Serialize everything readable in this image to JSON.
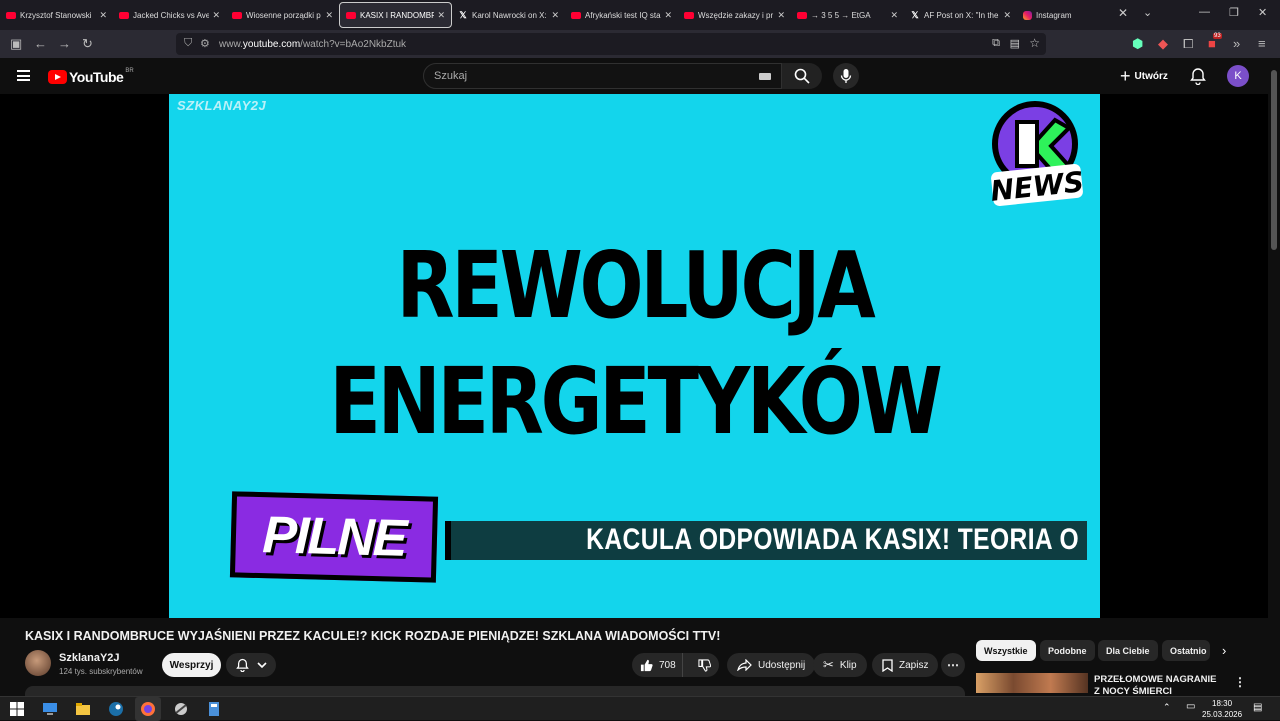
{
  "browser": {
    "tabs": [
      {
        "title": "Krzysztof Stanowski",
        "icon": "youtube-icon",
        "active": false
      },
      {
        "title": "Jacked Chicks vs Aver",
        "icon": "youtube-icon",
        "active": false
      },
      {
        "title": "Wiosenne porządki p",
        "icon": "youtube-icon",
        "active": false
      },
      {
        "title": "KASIX I RANDOMBRU",
        "icon": "youtube-icon",
        "active": true
      },
      {
        "title": "Karol Nawrocki on X:",
        "icon": "x-icon",
        "active": false
      },
      {
        "title": "Afrykański test IQ sta",
        "icon": "youtube-icon",
        "active": false
      },
      {
        "title": "Wszędzie zakazy i pr",
        "icon": "youtube-icon",
        "active": false
      },
      {
        "title": "→ 3 5 5 → EtGA",
        "icon": "youtube-icon",
        "active": false
      },
      {
        "title": "AF Post on X: \"In the",
        "icon": "x-icon",
        "active": false
      },
      {
        "title": "Instagram",
        "icon": "instagram-icon",
        "active": false
      }
    ],
    "url_prefix": "www.",
    "url_domain": "youtube.com",
    "url_path": "/watch?v=bAo2NkbZtuk",
    "extension_badge": "93"
  },
  "youtube": {
    "logo_text": "YouTube",
    "country_code": "BR",
    "search_placeholder": "Szukaj",
    "create_label": "Utwórz",
    "avatar_letter": "K"
  },
  "video": {
    "watermark": "SZKLANAY2J",
    "news_logo_text": "NEWS",
    "headline_line1": "REWOLUCJA",
    "headline_line2": "ENERGETYKÓW",
    "badge": "PILNE",
    "ticker": "KACULA ODPOWIADA KASIX! TEORIA O",
    "title": "KASIX I RANDOMBRUCE WYJAŚNIENI PRZEZ KACULE!? KICK ROZDAJE PIENIĄDZE! SZKLANA WIADOMOŚCI TTV!",
    "channel_name": "SzklanaY2J",
    "subscribers": "124 tys. subskrybentów",
    "support_label": "Wesprzyj",
    "likes": "708",
    "share_label": "Udostępnij",
    "clip_label": "Klip",
    "save_label": "Zapisz"
  },
  "sidebar": {
    "chips": [
      "Wszystkie",
      "Podobne",
      "Dla Ciebie",
      "Ostatnio"
    ],
    "rec_title": "PRZEŁOMOWE NAGRANIE Z NOCY ŚMIERCI EPSTEINA?"
  },
  "taskbar": {
    "time": "18:30",
    "date": "25.03.2026"
  },
  "colors": {
    "frame_bg": "#13d5ec",
    "badge_bg": "#8a2be2",
    "ticker_bg": "#0e3d41",
    "yt_red": "#ff0000"
  }
}
